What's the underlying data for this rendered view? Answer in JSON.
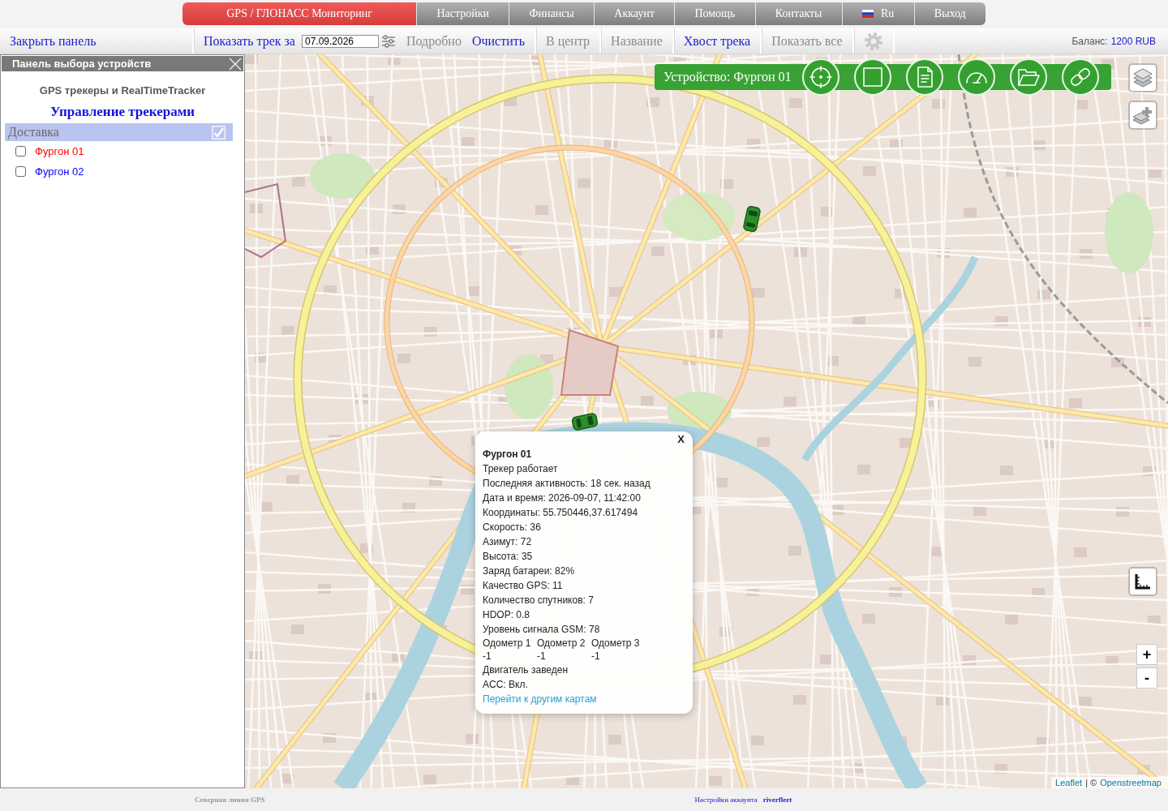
{
  "nav": {
    "tabs": [
      {
        "label": "GPS / ГЛОНАСС Мониторинг",
        "kind": "text",
        "selected": true
      },
      {
        "label": "Настройки",
        "kind": "text",
        "selected": false
      },
      {
        "label": "Финансы",
        "kind": "text",
        "selected": false
      },
      {
        "label": "Аккаунт",
        "kind": "text",
        "selected": false
      },
      {
        "label": "Помощь",
        "kind": "text",
        "selected": false
      },
      {
        "label": "Контакты",
        "kind": "text",
        "selected": false
      },
      {
        "label": "Ru",
        "kind": "language",
        "selected": false
      },
      {
        "label": "Выход",
        "kind": "text",
        "selected": false
      }
    ]
  },
  "toolbar": {
    "close_panel": "Закрыть панель",
    "track_label": "Показать трек за",
    "date_value": "07.09.2026",
    "sections": [
      [
        {
          "label": "Подробно",
          "disabled": true
        },
        {
          "label": "Очистить",
          "disabled": false
        }
      ],
      [
        {
          "label": "В центр",
          "disabled": true
        }
      ],
      [
        {
          "label": "Название",
          "disabled": true
        }
      ],
      [
        {
          "label": "Хвост трека",
          "disabled": false
        }
      ],
      [
        {
          "label": "Показать все",
          "disabled": true
        }
      ]
    ],
    "balance_label": "Баланс:",
    "balance_value": "1200 RUB"
  },
  "panel": {
    "title": "Панель выбора устройств",
    "subtitle": "GPS трекеры и RealTimeTracker",
    "heading": "Управление трекерами",
    "groups": [
      {
        "name": "Доставка",
        "checked": true,
        "devices": [
          {
            "name": "Фургон 01",
            "checked": false,
            "color": "#ff0000"
          },
          {
            "name": "Фургон 02",
            "checked": false,
            "color": "#0000ff"
          }
        ]
      }
    ]
  },
  "map": {
    "device_bar": "Устройство: Фургон 01",
    "zoom_in": "+",
    "zoom_out": "-",
    "attribution": {
      "leaflet": "Leaflet",
      "separator": "| ©",
      "osm": "Openstreetmap"
    }
  },
  "popup": {
    "close": "X",
    "title": "Фургон 01",
    "lines": [
      "Трекер работает",
      "Последняя активность: 18 сек. назад",
      "Дата и время: 2026-09-07, 11:42:00",
      "Координаты: 55.750446,37.617494",
      "Скорость: 36",
      "Азимут: 72",
      "Высота: 35",
      "Заряд батареи: 82%",
      "Качество GPS: 11",
      "Количество спутников: 7",
      "HDOP: 0.8",
      "Уровень сигнала GSM: 78"
    ],
    "odometers": [
      {
        "label": "Одометр 1",
        "value": "-1"
      },
      {
        "label": "Одометр 2",
        "value": "-1"
      },
      {
        "label": "Одометр 3",
        "value": "-1"
      }
    ],
    "extra_lines": [
      "Двигатель заведен",
      "ACC: Вкл."
    ],
    "link": "Перейти к другим картам"
  },
  "footer": {
    "brand": "Северная линия GPS",
    "settings_link": "Настройки аккаунта",
    "user": "riverfleet"
  }
}
